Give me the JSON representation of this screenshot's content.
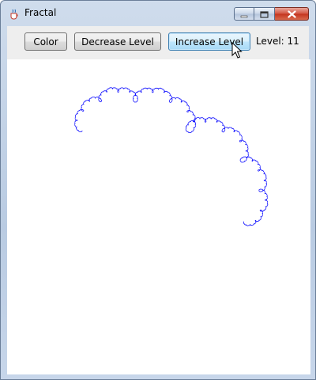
{
  "window": {
    "title": "Fractal",
    "app_icon": "java-cup-icon"
  },
  "title_bar_buttons": {
    "minimize_icon": "minimize-icon",
    "maximize_icon": "maximize-icon",
    "close_icon": "close-icon"
  },
  "toolbar": {
    "color_label": "Color",
    "decrease_label": "Decrease Level",
    "increase_label": "Increase Level",
    "level_text": "Level: 11"
  },
  "canvas": {
    "background": "#ffffff",
    "fractal_color": "#0000ff",
    "fractal_level": 11
  },
  "colors": {
    "title_bar": "#c7d6ea",
    "close_button": "#c4331d",
    "focus_border": "#3c7fb1"
  }
}
